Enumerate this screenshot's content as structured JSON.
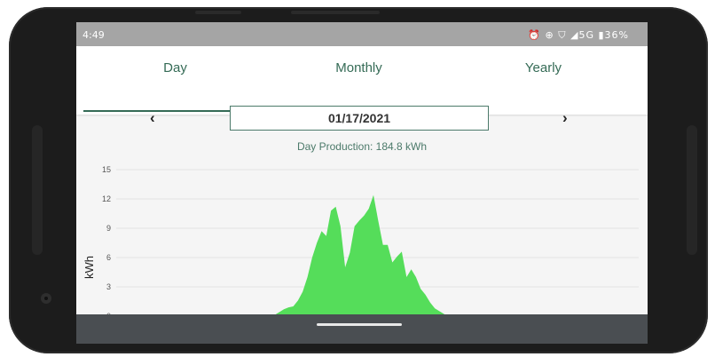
{
  "status_bar": {
    "time": "4:49",
    "icons_text": "⏰ ⊕ ⛉ ◢5G ▮36%"
  },
  "tabs": [
    {
      "label": "Day",
      "active": true
    },
    {
      "label": "Monthly",
      "active": false
    },
    {
      "label": "Yearly",
      "active": false
    }
  ],
  "date_nav": {
    "prev": "‹",
    "next": "›",
    "date": "01/17/2021"
  },
  "production_text": "Day Production: 184.8 kWh",
  "colors": {
    "accent": "#356b56",
    "area_fill": "#55dd5a",
    "status_bar": "#a5a5a5",
    "nav_bar": "#4a4e52"
  },
  "chart_data": {
    "type": "area",
    "title": "",
    "xlabel": "",
    "ylabel": "kWh",
    "ylim": [
      0,
      15
    ],
    "yticks": [
      0,
      3,
      6,
      9,
      12,
      15
    ],
    "grid": true,
    "x": [
      0,
      1,
      2,
      3,
      4,
      5,
      6,
      7,
      8,
      9,
      10,
      11,
      12,
      13,
      14,
      15,
      16,
      17,
      18,
      19,
      20,
      21,
      22,
      23,
      24,
      25,
      26,
      27,
      28,
      29,
      30,
      31,
      32,
      33,
      34,
      35,
      36,
      37,
      38,
      39,
      40,
      41,
      42,
      43,
      44,
      45,
      46,
      47
    ],
    "values": [
      0,
      0.1,
      0.4,
      0.7,
      0.9,
      1.0,
      1.6,
      2.5,
      4.0,
      6.0,
      7.5,
      8.7,
      8.2,
      10.8,
      11.2,
      9.2,
      5.0,
      6.5,
      9.2,
      9.8,
      10.3,
      11.0,
      12.4,
      9.8,
      7.3,
      7.3,
      5.5,
      6.1,
      6.6,
      4.0,
      4.8,
      4.0,
      2.8,
      2.2,
      1.4,
      0.8,
      0.5,
      0.2,
      0,
      0,
      0,
      0,
      0,
      0,
      0,
      0,
      0,
      0
    ]
  }
}
